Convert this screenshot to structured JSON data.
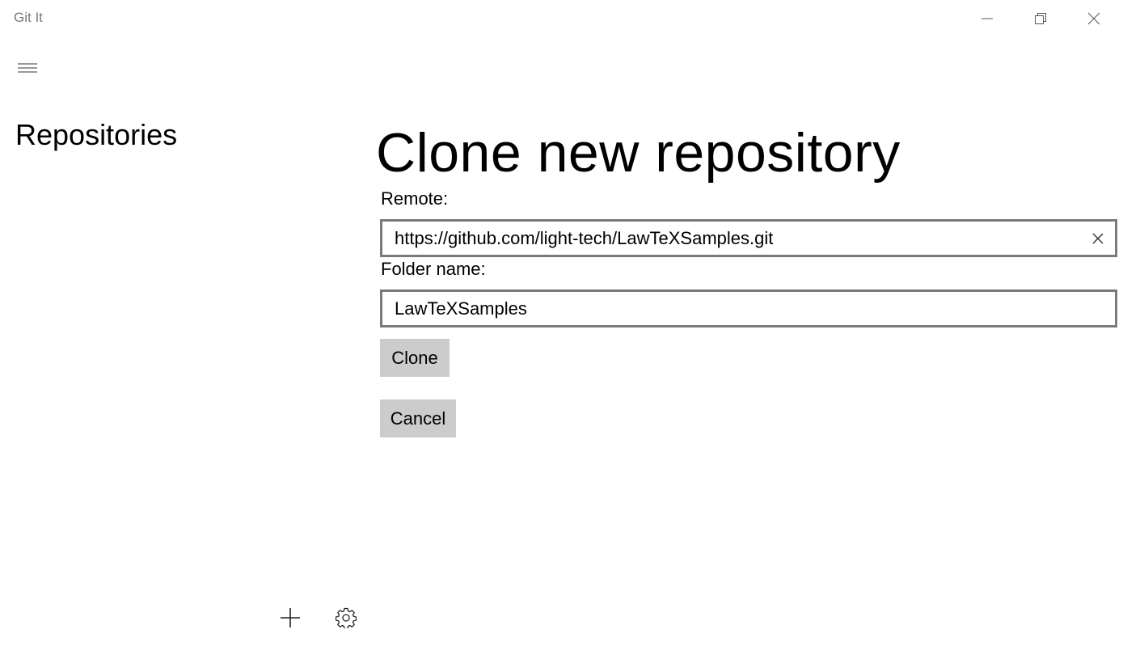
{
  "window": {
    "title": "Git It"
  },
  "icons": {
    "minimize": "minimize-icon",
    "maximize": "restore-icon",
    "close": "close-icon",
    "menu": "hamburger-icon",
    "add": "plus-icon",
    "settings": "gear-icon",
    "clear": "clear-icon"
  },
  "sidebar": {
    "title": "Repositories"
  },
  "main": {
    "title": "Clone new repository",
    "remote_label": "Remote:",
    "remote_value": "https://github.com/light-tech/LawTeXSamples.git",
    "folder_label": "Folder name:",
    "folder_value": "LawTeXSamples",
    "clone_button": "Clone",
    "cancel_button": "Cancel"
  },
  "colors": {
    "title_text": "#7a7a7a",
    "button_bg": "#cccccc",
    "textbox_border": "#7a7a7a"
  }
}
